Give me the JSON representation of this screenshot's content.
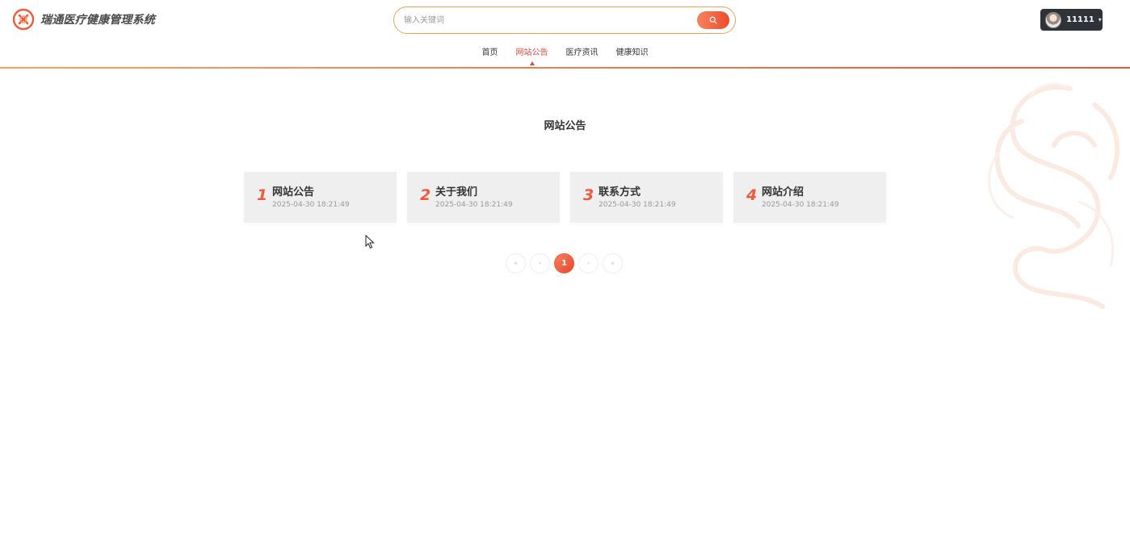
{
  "app": {
    "title": "瑞通医疗健康管理系统"
  },
  "search": {
    "placeholder": "输入关键词"
  },
  "user": {
    "name": "11111",
    "caret": "▾"
  },
  "nav": {
    "items": [
      {
        "label": "首页",
        "active": false
      },
      {
        "label": "网站公告",
        "active": true
      },
      {
        "label": "医疗资讯",
        "active": false
      },
      {
        "label": "健康知识",
        "active": false
      }
    ]
  },
  "main": {
    "title": "网站公告",
    "cards": [
      {
        "num": "1",
        "title": "网站公告",
        "date": "2025-04-30 18:21:49"
      },
      {
        "num": "2",
        "title": "关于我们",
        "date": "2025-04-30 18:21:49"
      },
      {
        "num": "3",
        "title": "联系方式",
        "date": "2025-04-30 18:21:49"
      },
      {
        "num": "4",
        "title": "网站介绍",
        "date": "2025-04-30 18:21:49"
      }
    ]
  },
  "pagination": {
    "first": "«",
    "prev": "‹",
    "current": "1",
    "next": "›",
    "last": "»"
  },
  "colors": {
    "accent": "#ee4b2b",
    "accent_light": "#f7835f",
    "search_border": "#e9a25a",
    "user_bg": "#2f3339",
    "card_bg": "#efefef"
  },
  "icons": {
    "logo": "medical-cross-heart-icon",
    "search": "search-icon",
    "avatar": "user-avatar",
    "decoration": "dragon-watermark"
  }
}
